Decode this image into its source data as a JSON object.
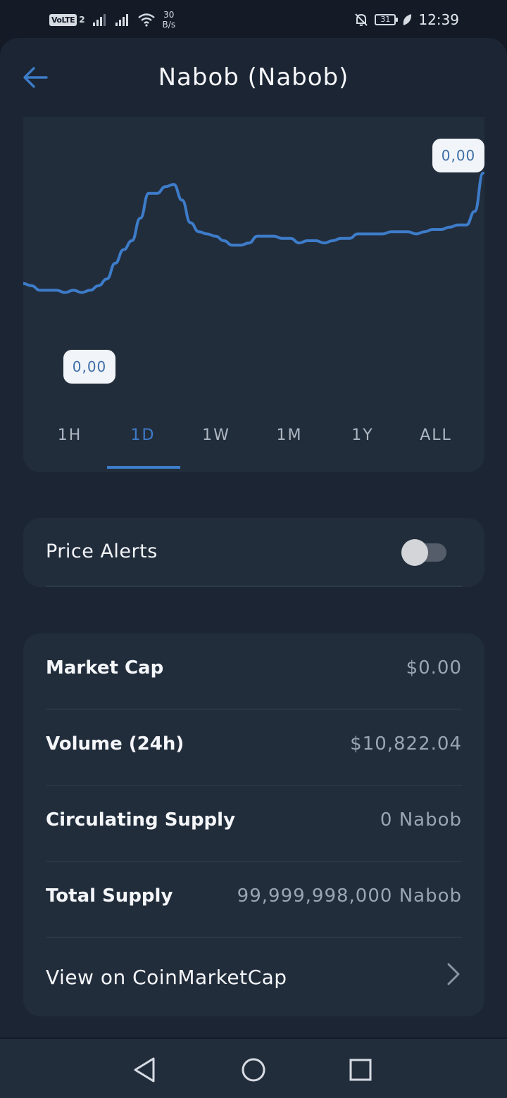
{
  "status_bar": {
    "volte": "VoLTE",
    "volte_sim": "2",
    "net_speed_value": "30",
    "net_speed_unit": "B/s",
    "battery": "31",
    "time": "12:39"
  },
  "header": {
    "title": "Nabob (Nabob)"
  },
  "chart": {
    "high_label": "0,00",
    "low_label": "0,00",
    "line_color": "#3d7cc9",
    "tabs": [
      "1H",
      "1D",
      "1W",
      "1M",
      "1Y",
      "ALL"
    ],
    "selected_tab": "1D"
  },
  "chart_data": {
    "type": "line",
    "series": [
      {
        "values": [
          0.51,
          0.5,
          0.48,
          0.48,
          0.48,
          0.47,
          0.48,
          0.47,
          0.48,
          0.5,
          0.53,
          0.6,
          0.66,
          0.7,
          0.8,
          0.91,
          0.91,
          0.94,
          0.95,
          0.88,
          0.78,
          0.74,
          0.73,
          0.72,
          0.7,
          0.68,
          0.68,
          0.69,
          0.72,
          0.72,
          0.72,
          0.71,
          0.71,
          0.69,
          0.7,
          0.7,
          0.69,
          0.7,
          0.71,
          0.71,
          0.73,
          0.73,
          0.73,
          0.73,
          0.74,
          0.74,
          0.74,
          0.73,
          0.74,
          0.75,
          0.75,
          0.76,
          0.77,
          0.77,
          0.83,
          1.0
        ]
      }
    ],
    "ylabel": "",
    "xlabel": "",
    "grid": false,
    "legend": "none"
  },
  "price_alerts": {
    "label": "Price Alerts",
    "enabled": false
  },
  "stats": [
    {
      "label": "Market Cap",
      "value": "$0.00"
    },
    {
      "label": "Volume (24h)",
      "value": "$10,822.04"
    },
    {
      "label": "Circulating Supply",
      "value": "0 Nabob"
    },
    {
      "label": "Total Supply",
      "value": "99,999,998,000 Nabob"
    }
  ],
  "link": {
    "label": "View on CoinMarketCap"
  },
  "icons": {
    "back": "arrow-left-icon",
    "chevron": "chevron-right-icon",
    "nav_back": "triangle-back-icon",
    "nav_home": "circle-home-icon",
    "nav_recents": "square-recents-icon"
  }
}
